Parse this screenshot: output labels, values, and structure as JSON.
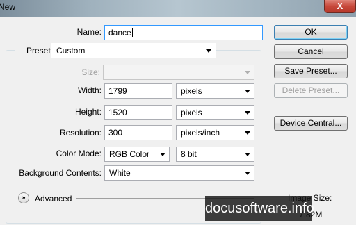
{
  "window": {
    "title": "New",
    "close_glyph": "X"
  },
  "name": {
    "label": "Name:",
    "value": "dance"
  },
  "preset": {
    "label": "Preset:",
    "value": "Custom"
  },
  "size": {
    "label": "Size:",
    "value": ""
  },
  "width": {
    "label": "Width:",
    "value": "1799",
    "unit": "pixels"
  },
  "height": {
    "label": "Height:",
    "value": "1520",
    "unit": "pixels"
  },
  "resolution": {
    "label": "Resolution:",
    "value": "300",
    "unit": "pixels/inch"
  },
  "color_mode": {
    "label": "Color Mode:",
    "mode": "RGB Color",
    "depth": "8 bit"
  },
  "background": {
    "label": "Background Contents:",
    "value": "White"
  },
  "advanced": {
    "label": "Advanced",
    "icon": "chevron-down-double-icon"
  },
  "buttons": {
    "ok": "OK",
    "cancel": "Cancel",
    "save_preset": "Save Preset...",
    "delete_preset": "Delete Preset...",
    "device_central": "Device Central..."
  },
  "image_size": {
    "label": "Image Size:",
    "value": "7.82M"
  },
  "watermark": "docusoftware.info"
}
